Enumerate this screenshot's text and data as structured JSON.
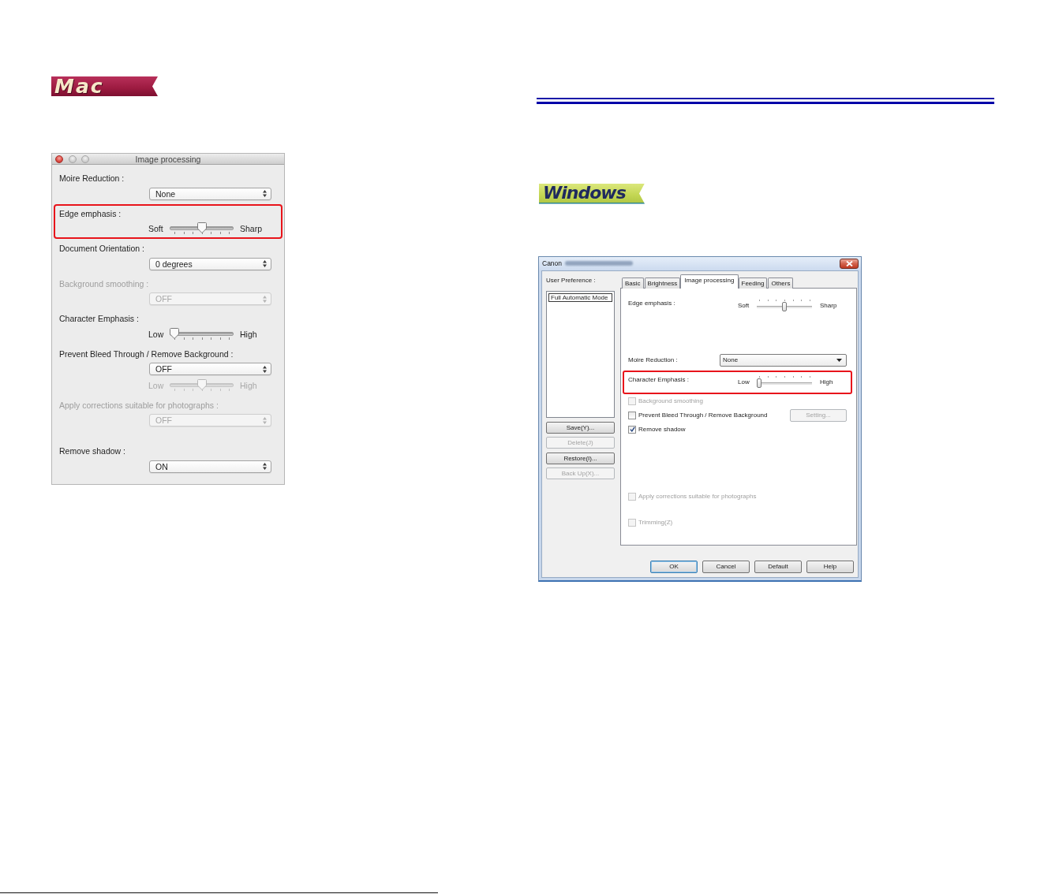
{
  "mac_banner": {
    "text": "Mac"
  },
  "mac_dialog": {
    "title": "Image processing",
    "window_buttons": [
      {
        "kind": "close",
        "disabled": false
      },
      {
        "kind": "minimize",
        "disabled": true
      },
      {
        "kind": "zoom",
        "disabled": true
      }
    ],
    "settings": [
      {
        "label": "Moire Reduction :",
        "disabled": false,
        "highlighted": false,
        "controls": [
          {
            "kind": "popup",
            "value": "None",
            "disabled": false
          }
        ]
      },
      {
        "label": "Edge emphasis :",
        "disabled": false,
        "highlighted": true,
        "controls": [
          {
            "kind": "slider",
            "min_label": "Soft",
            "max_label": "Sharp",
            "level": 0.5,
            "disabled": false
          }
        ]
      },
      {
        "label": "Document Orientation :",
        "disabled": false,
        "highlighted": false,
        "controls": [
          {
            "kind": "popup",
            "value": "0 degrees",
            "disabled": false
          }
        ]
      },
      {
        "label": "Background smoothing :",
        "disabled": true,
        "highlighted": false,
        "controls": [
          {
            "kind": "popup",
            "value": "OFF",
            "disabled": true
          }
        ]
      },
      {
        "label": "Character Emphasis :",
        "disabled": false,
        "highlighted": false,
        "controls": [
          {
            "kind": "slider",
            "min_label": "Low",
            "max_label": "High",
            "level": 0,
            "disabled": false
          }
        ]
      },
      {
        "label": "Prevent Bleed Through / Remove Background :",
        "disabled": false,
        "highlighted": false,
        "controls": [
          {
            "kind": "popup",
            "value": "OFF",
            "disabled": false
          },
          {
            "kind": "slider",
            "min_label": "Low",
            "max_label": "High",
            "level": 0.5,
            "disabled": true
          }
        ]
      },
      {
        "label": "Apply corrections suitable for photographs :",
        "disabled": true,
        "highlighted": false,
        "controls": [
          {
            "kind": "popup",
            "value": "OFF",
            "disabled": true
          }
        ]
      },
      {
        "label": "Remove shadow :",
        "disabled": false,
        "highlighted": false,
        "controls": [
          {
            "kind": "popup",
            "value": "ON",
            "disabled": false
          }
        ]
      }
    ]
  },
  "windows_banner": {
    "text": "Windows"
  },
  "windows_dialog": {
    "title": "Canon",
    "preference_label": "User Preference :",
    "preferences": [
      {
        "label": "Full Automatic Mode",
        "selected": true
      }
    ],
    "preference_buttons": [
      {
        "label": "Save(Y)...",
        "disabled": false
      },
      {
        "label": "Delete(J)",
        "disabled": true
      },
      {
        "label": "Restore(I)...",
        "disabled": false
      },
      {
        "label": "Back Up(X)...",
        "disabled": true
      }
    ],
    "tabs": [
      {
        "label": "Basic",
        "selected": false
      },
      {
        "label": "Brightness",
        "selected": false
      },
      {
        "label": "Image processing",
        "selected": true
      },
      {
        "label": "Feeding",
        "selected": false
      },
      {
        "label": "Others",
        "selected": false
      }
    ],
    "settings": [
      {
        "kind": "slider",
        "label": "Edge emphasis :",
        "min_label": "Soft",
        "max_label": "Sharp",
        "level": 0.5,
        "highlighted": false
      },
      {
        "kind": "dropdown",
        "label": "Moire Reduction :",
        "value": "None",
        "highlighted": false
      },
      {
        "kind": "slider",
        "label": "Character Emphasis :",
        "min_label": "Low",
        "max_label": "High",
        "level": 0,
        "highlighted": true
      },
      {
        "kind": "checkbox",
        "label": "Background smoothing",
        "checked": false,
        "disabled": true,
        "highlighted": false
      },
      {
        "kind": "checkbox",
        "label": "Prevent Bleed Through / Remove Background",
        "checked": false,
        "disabled": false,
        "highlighted": false,
        "button": {
          "label": "Setting...",
          "disabled": true
        }
      },
      {
        "kind": "checkbox",
        "label": "Remove shadow",
        "checked": true,
        "disabled": false,
        "highlighted": false
      },
      {
        "kind": "checkbox",
        "label": "Apply corrections suitable for photographs",
        "checked": false,
        "disabled": true,
        "highlighted": false
      },
      {
        "kind": "checkbox",
        "label": "Trimming(Z)",
        "checked": false,
        "disabled": true,
        "highlighted": false
      }
    ],
    "buttons": [
      {
        "label": "OK",
        "default": true
      },
      {
        "label": "Cancel",
        "default": false
      },
      {
        "label": "Default",
        "default": false
      },
      {
        "label": "Help",
        "default": false
      }
    ]
  }
}
